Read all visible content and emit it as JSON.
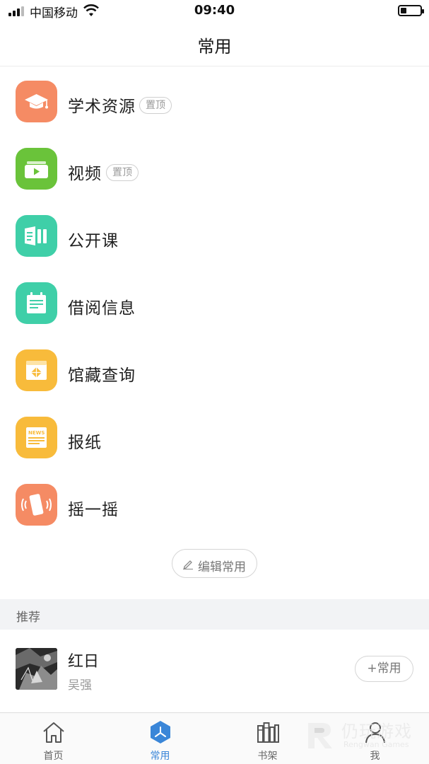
{
  "status_bar": {
    "carrier": "中国移动",
    "time": "09:40",
    "battery_level": 0.3
  },
  "nav": {
    "title": "常用"
  },
  "favorites": [
    {
      "label": "学术资源",
      "icon": "graduation-cap-icon",
      "color": "#f58b64",
      "pinned": true,
      "pin_label": "置顶"
    },
    {
      "label": "视频",
      "icon": "video-icon",
      "color": "#6ac33a",
      "pinned": true,
      "pin_label": "置顶"
    },
    {
      "label": "公开课",
      "icon": "open-course-icon",
      "color": "#3fcfa8"
    },
    {
      "label": "借阅信息",
      "icon": "borrow-calendar-icon",
      "color": "#3fcfa8"
    },
    {
      "label": "馆藏查询",
      "icon": "collection-box-icon",
      "color": "#f8bb3b"
    },
    {
      "label": "报纸",
      "icon": "newspaper-icon",
      "color": "#f8bb3b"
    },
    {
      "label": "摇一摇",
      "icon": "shake-phone-icon",
      "color": "#f58b64"
    }
  ],
  "newspaper_icon_text": "NEWS",
  "edit_button": {
    "label": "编辑常用"
  },
  "recommend": {
    "title": "推荐",
    "items": [
      {
        "title": "红日",
        "author": "吴强",
        "add_label": "+常用"
      }
    ]
  },
  "tabs": [
    {
      "label": "首页",
      "icon": "home-icon",
      "active": false
    },
    {
      "label": "常用",
      "icon": "common-hexagon-icon",
      "active": true
    },
    {
      "label": "书架",
      "icon": "bookshelf-icon",
      "active": false
    },
    {
      "label": "我",
      "icon": "person-icon",
      "active": false
    }
  ],
  "watermark": {
    "text": "仍玩游戏",
    "sub": "Rengwan Games"
  },
  "colors": {
    "accent": "#3a86d8"
  }
}
